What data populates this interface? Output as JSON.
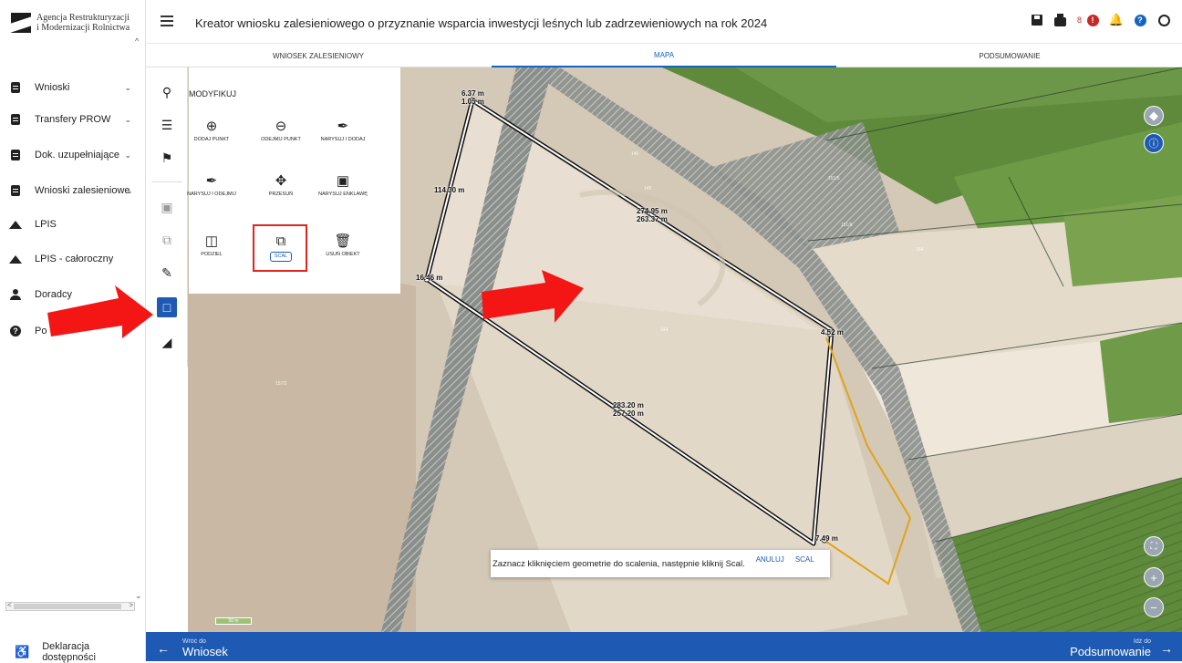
{
  "logo": {
    "line1": "Agencja Restrukturyzacji",
    "line2": "i Modernizacji Rolnictwa"
  },
  "sidebar": {
    "items": [
      {
        "label": "Wnioski",
        "icon": "document-icon",
        "chevron": true
      },
      {
        "label": "Transfery PROW",
        "icon": "document-icon",
        "chevron": true
      },
      {
        "label": "Dok. uzupełniające",
        "icon": "document-icon",
        "chevron": true
      },
      {
        "label": "Wnioski zalesieniowe",
        "icon": "document-icon",
        "chevron": true
      },
      {
        "label": "LPIS",
        "icon": "mountain-icon",
        "chevron": false
      },
      {
        "label": "LPIS - całoroczny",
        "icon": "mountain-icon",
        "chevron": false
      },
      {
        "label": "Doradcy",
        "icon": "user-icon",
        "chevron": false
      },
      {
        "label": "Po",
        "icon": "help-icon",
        "chevron": false
      }
    ],
    "accessibility": "Deklaracja dostępności"
  },
  "header": {
    "title": "Kreator wniosku zalesieniowego o przyznanie wsparcia inwestycji leśnych lub zadrzewieniowych na rok 2024",
    "notification_count": "8"
  },
  "tabs": [
    {
      "label": "WNIOSEK ZALESIENIOWY",
      "active": false
    },
    {
      "label": "MAPA",
      "active": true
    },
    {
      "label": "PODSUMOWANIE",
      "active": false
    }
  ],
  "panel": {
    "title": "MODYFIKUJ",
    "tools": [
      {
        "label": "DODAJ PUNKT",
        "icon": "add-point-icon"
      },
      {
        "label": "ODEJMIJ PUNKT",
        "icon": "remove-point-icon"
      },
      {
        "label": "NARYSUJ I DODAJ",
        "icon": "draw-add-icon"
      },
      {
        "label": "NARYSUJ I ODEJMIJ",
        "icon": "draw-subtract-icon"
      },
      {
        "label": "PRZESUŃ",
        "icon": "move-icon"
      },
      {
        "label": "NARYSUJ ENKLAWĘ",
        "icon": "enclave-icon"
      },
      {
        "label": "PODZIEL",
        "icon": "split-icon"
      },
      {
        "label": "SCAL",
        "icon": "merge-icon",
        "highlighted": true
      },
      {
        "label": "USUŃ OBIEKT",
        "icon": "delete-icon"
      }
    ]
  },
  "map": {
    "parcel_labels": [
      "146",
      "145",
      "151/5",
      "151/6",
      "154",
      "144",
      "157/2"
    ],
    "dimensions": [
      {
        "l1": "6.37 m",
        "l2": "1.05 m"
      },
      {
        "l1": "114.30 m",
        "l2": ""
      },
      {
        "l1": "274.95 m",
        "l2": "263.37 m"
      },
      {
        "l1": "16.46 m",
        "l2": ""
      },
      {
        "l1": "4.52 m",
        "l2": ""
      },
      {
        "l1": "283.20 m",
        "l2": "257.20 m"
      },
      {
        "l1": "7.49 m",
        "l2": ""
      }
    ],
    "scale_label": "50 m"
  },
  "hint": {
    "message": "Zaznacz kliknięciem geometrie do scalenia, następnie kliknij Scal.",
    "cancel": "ANULUJ",
    "confirm": "SCAL"
  },
  "footer": {
    "back_small": "Wróć do",
    "back_label": "Wniosek",
    "next_small": "Idź do",
    "next_label": "Podsumowanie"
  },
  "colors": {
    "primary": "#1e5ab4",
    "highlight": "#e0251c",
    "arrow": "#f41515"
  }
}
